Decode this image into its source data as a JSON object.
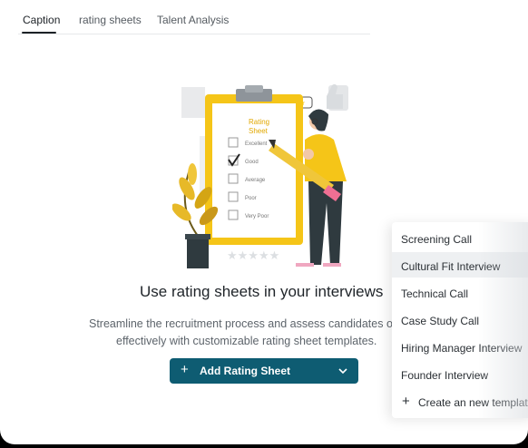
{
  "tabs": [
    {
      "label": "Caption"
    },
    {
      "label": "rating sheets"
    },
    {
      "label": "Talent Analysis"
    }
  ],
  "illustration": {
    "sheet_title_line1": "Rating",
    "sheet_title_line2": "Sheet",
    "options": [
      "Excellent",
      "Good",
      "Average",
      "Poor",
      "Very Poor"
    ],
    "checked_option": "Good"
  },
  "empty_state": {
    "headline": "Use rating sheets in your interviews",
    "sub_line1": "Streamline the recruitment process and assess candidates obje",
    "sub_line2": "effectively with customizable rating sheet templates."
  },
  "add_button": {
    "label": "Add Rating Sheet"
  },
  "dropdown": {
    "items": [
      {
        "label": "Screening Call"
      },
      {
        "label": "Cultural Fit Interview"
      },
      {
        "label": "Technical Call"
      },
      {
        "label": "Case Study Call"
      },
      {
        "label": "Hiring Manager Interview"
      },
      {
        "label": "Founder Interview"
      }
    ],
    "create_label": "Create an new template"
  },
  "colors": {
    "accent": "#0e5c72",
    "illustration_yellow": "#f5c518",
    "illustration_dark": "#2f3a3f"
  }
}
